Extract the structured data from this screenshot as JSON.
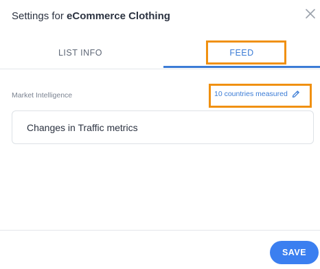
{
  "dialog": {
    "title_prefix": "Settings for ",
    "title_name": "eCommerce Clothing"
  },
  "tabs": [
    {
      "label": "LIST INFO",
      "active": false
    },
    {
      "label": "FEED",
      "active": true
    }
  ],
  "market_intelligence": {
    "label": "Market Intelligence",
    "countries_link": "10 countries measured",
    "countries_icon": "pencil-icon"
  },
  "metrics": [
    {
      "label": "Changes in Traffic metrics"
    }
  ],
  "footer": {
    "save_label": "SAVE"
  },
  "colors": {
    "accent": "#3a7bd5",
    "save_button": "#3b7ff0",
    "highlight": "#f0900f"
  }
}
